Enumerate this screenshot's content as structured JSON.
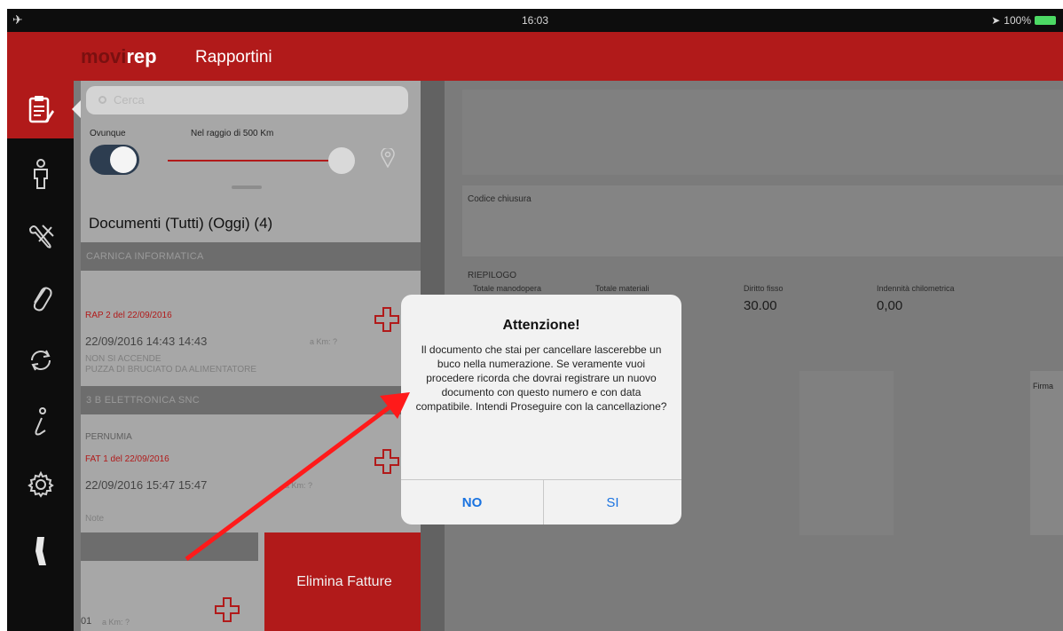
{
  "status_bar": {
    "time": "16:03",
    "battery": "100%"
  },
  "app": {
    "brand_part1": "movi",
    "brand_part2": "rep",
    "title": "Rapportini"
  },
  "sidebar": {
    "items": [
      {
        "icon": "clipboard-icon",
        "active": true
      },
      {
        "icon": "person-icon"
      },
      {
        "icon": "tools-icon"
      },
      {
        "icon": "paperclip-icon"
      },
      {
        "icon": "sync-icon"
      },
      {
        "icon": "info-icon"
      },
      {
        "icon": "gear-icon"
      },
      {
        "icon": "logout-icon"
      }
    ]
  },
  "list": {
    "search_placeholder": "Cerca",
    "filter_anywhere_label": "Ovunque",
    "filter_radius_label": "Nel raggio di 500 Km",
    "header": "Documenti (Tutti) (Oggi) (4)",
    "groups": [
      {
        "company": "CARNICA INFORMATICA",
        "doc_title": "RAP 2 del 22/09/2016",
        "doc_time": "22/09/2016  14:43  14:43",
        "km": "a Km: ?",
        "notes": [
          "NON SI ACCENDE",
          "PUZZA DI BRUCIATO DA ALIMENTATORE"
        ]
      },
      {
        "company": "3 B ELETTRONICA SNC",
        "client": "PERNUMIA",
        "doc_title": "FAT 1 del 22/09/2016",
        "doc_time": "22/09/2016  15:47  15:47",
        "km": "a Km: ?",
        "notes": [
          "Note"
        ]
      }
    ],
    "partial_row_num": "01",
    "partial_row_km": "a Km: ?",
    "delete_action": "Elimina Fatture"
  },
  "detail": {
    "codice_chiusura_label": "Codice chiusura",
    "riepilogo_label": "RIEPILOGO",
    "columns": [
      "Totale manodopera",
      "Totale materiali",
      "Diritto fisso",
      "Indennità chilometrica"
    ],
    "diritto_fisso_value": "30.00",
    "indennita_value": "0,00",
    "firma_label": "Firma"
  },
  "dialog": {
    "title": "Attenzione!",
    "message": "Il documento che stai per cancellare lascerebbe un buco nella numerazione. Se veramente vuoi procedere ricorda che dovrai registrare un nuovo documento con questo numero e con data compatibile. Intendi Proseguire con la cancellazione?",
    "no_label": "NO",
    "yes_label": "SI"
  },
  "colors": {
    "brand_red": "#b11a1a",
    "dialog_button_blue": "#1a73e0",
    "annotation_arrow": "#ff1a1a"
  }
}
